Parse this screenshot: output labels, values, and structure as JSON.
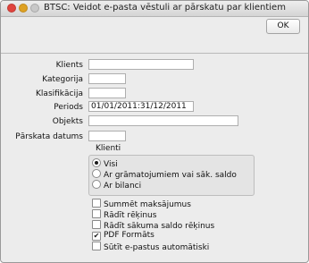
{
  "window": {
    "title": "BTSC: Veidot e-pasta vēstuli ar pārskatu par klientiem"
  },
  "toolbar": {
    "ok_label": "OK"
  },
  "form": {
    "fields": [
      {
        "label": "Klients",
        "value": ""
      },
      {
        "label": "Kategorija",
        "value": ""
      },
      {
        "label": "Klasifikācija",
        "value": ""
      },
      {
        "label": "Periods",
        "value": "01/01/2011:31/12/2011"
      },
      {
        "label": "Objekts",
        "value": ""
      },
      {
        "label": "Pārskata datums",
        "value": ""
      }
    ]
  },
  "klienti": {
    "title": "Klienti",
    "options": [
      {
        "label": "Visi",
        "selected": true
      },
      {
        "label": "Ar grāmatojumiem vai sāk. saldo",
        "selected": false
      },
      {
        "label": "Ar bilanci",
        "selected": false
      }
    ]
  },
  "options": [
    {
      "label": "Summēt maksājumus",
      "checked": false
    },
    {
      "label": "Rādīt rēķinus",
      "checked": false
    },
    {
      "label": "Rādīt sākuma saldo rēķinus",
      "checked": false
    },
    {
      "label": "PDF Formāts",
      "checked": true
    },
    {
      "label": "Sūtīt e-pastus automātiski",
      "checked": false
    }
  ]
}
